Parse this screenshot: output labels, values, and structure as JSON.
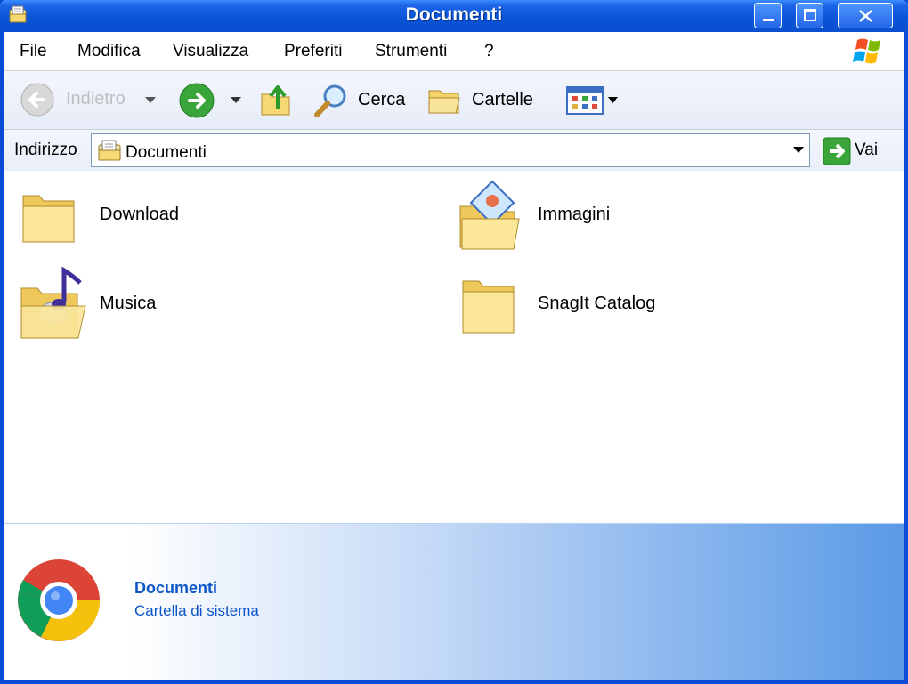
{
  "window": {
    "title": "Documenti"
  },
  "menu": {
    "items": [
      "File",
      "Modifica",
      "Visualizza",
      "Preferiti",
      "Strumenti",
      "?"
    ]
  },
  "toolbar": {
    "back_label": "Indietro",
    "search_label": "Cerca",
    "folders_label": "Cartelle"
  },
  "address": {
    "label": "Indirizzo",
    "value": "Documenti",
    "go_label": "Vai"
  },
  "items": [
    {
      "name": "Download",
      "icon": "folder-icon"
    },
    {
      "name": "Immagini",
      "icon": "pictures-folder-icon"
    },
    {
      "name": "Musica",
      "icon": "music-folder-icon"
    },
    {
      "name": "SnagIt Catalog",
      "icon": "folder-icon"
    }
  ],
  "details": {
    "name": "Documenti",
    "type": "Cartella di sistema",
    "icon": "chrome-icon"
  },
  "colors": {
    "titlebar": "#0b55d9",
    "details_text": "#0a55c8",
    "folder": "#f6d874"
  }
}
